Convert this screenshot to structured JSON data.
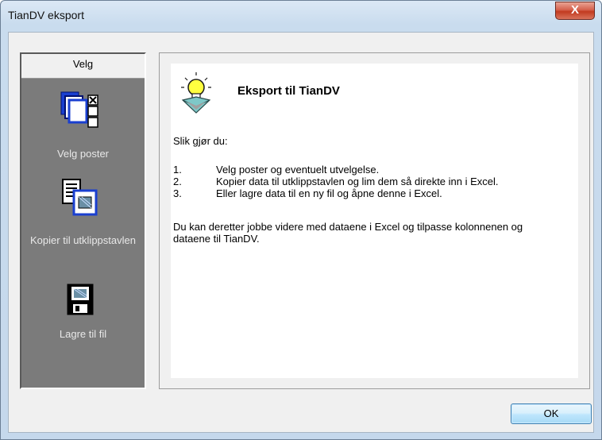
{
  "window": {
    "title": "TianDV eksport",
    "close_glyph": "X"
  },
  "sidebar": {
    "header": "Velg",
    "items": [
      {
        "label": "Velg poster",
        "icon": "select-records-icon"
      },
      {
        "label": "Kopier til utklippstavlen",
        "icon": "copy-to-clipboard-icon"
      },
      {
        "label": "Lagre til fil",
        "icon": "save-floppy-icon"
      }
    ]
  },
  "content": {
    "heading": "Eksport til TianDV",
    "heading_icon": "lightbulb-icon",
    "intro": "Slik gjør du:",
    "steps": [
      {
        "num": "1.",
        "text": "Velg poster og eventuelt utvelgelse."
      },
      {
        "num": "2.",
        "text": "Kopier data til utklippstavlen og lim dem så direkte inn i Excel."
      },
      {
        "num": "3.",
        "text": "Eller lagre data til en ny fil og åpne denne i Excel."
      }
    ],
    "outro": "Du kan deretter jobbe videre med dataene i Excel og tilpasse kolonnenen og dataene til TianDV."
  },
  "buttons": {
    "ok": "OK"
  }
}
